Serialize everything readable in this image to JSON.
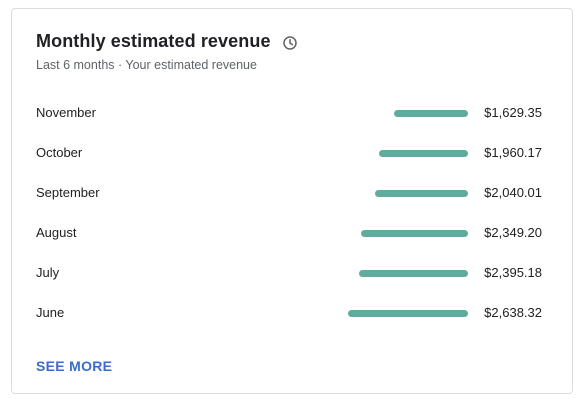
{
  "card": {
    "title": "Monthly estimated revenue",
    "title_icon": "clock-icon",
    "subtitle": "Last 6 months · Your estimated revenue",
    "see_more_label": "SEE MORE"
  },
  "colors": {
    "bar": "#5fac9d",
    "link": "#3b6ec7",
    "border": "#dadce0"
  },
  "rows": [
    {
      "month": "November",
      "amount": "$1,629.35",
      "value": 1629.35
    },
    {
      "month": "October",
      "amount": "$1,960.17",
      "value": 1960.17
    },
    {
      "month": "September",
      "amount": "$2,040.01",
      "value": 2040.01
    },
    {
      "month": "August",
      "amount": "$2,349.20",
      "value": 2349.2
    },
    {
      "month": "July",
      "amount": "$2,395.18",
      "value": 2395.18
    },
    {
      "month": "June",
      "amount": "$2,638.32",
      "value": 2638.32
    }
  ]
}
